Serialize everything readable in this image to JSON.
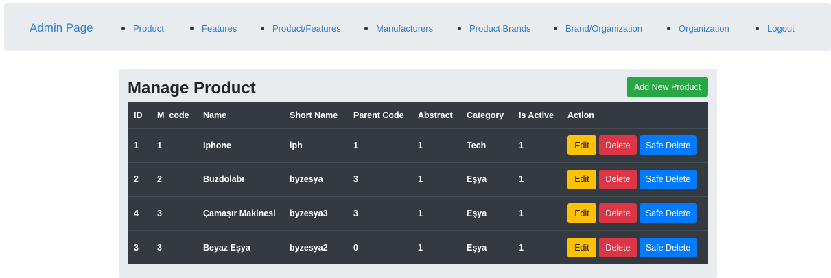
{
  "navbar": {
    "brand": "Admin Page",
    "items": [
      "Product",
      "Features",
      "Product/Features",
      "Manufacturers",
      "Product Brands",
      "Brand/Organization",
      "Organization",
      "Logout"
    ]
  },
  "page": {
    "title_prefix": "Manage",
    "title_bold": "Product",
    "add_button": "Add New Product"
  },
  "table": {
    "headers": [
      "ID",
      "M_code",
      "Name",
      "Short Name",
      "Parent Code",
      "Abstract",
      "Category",
      "Is Active",
      "Action"
    ],
    "rows": [
      [
        "1",
        "1",
        "Iphone",
        "iph",
        "1",
        "1",
        "Tech",
        "1"
      ],
      [
        "2",
        "2",
        "Buzdolabı",
        "byzesya",
        "3",
        "1",
        "Eşya",
        "1"
      ],
      [
        "4",
        "3",
        "Çamaşır Makinesi",
        "byzesya3",
        "3",
        "1",
        "Eşya",
        "1"
      ],
      [
        "3",
        "3",
        "Beyaz Eşya",
        "byzesya2",
        "0",
        "1",
        "Eşya",
        "1"
      ]
    ],
    "actions": {
      "edit": "Edit",
      "delete": "Delete",
      "safe_delete": "Safe Delete"
    }
  },
  "colors": {
    "link": "#2f7fd6",
    "success": "#28a745",
    "warning": "#ffc107",
    "danger": "#dc3545",
    "primary": "#007bff",
    "table_dark": "#343a40"
  }
}
